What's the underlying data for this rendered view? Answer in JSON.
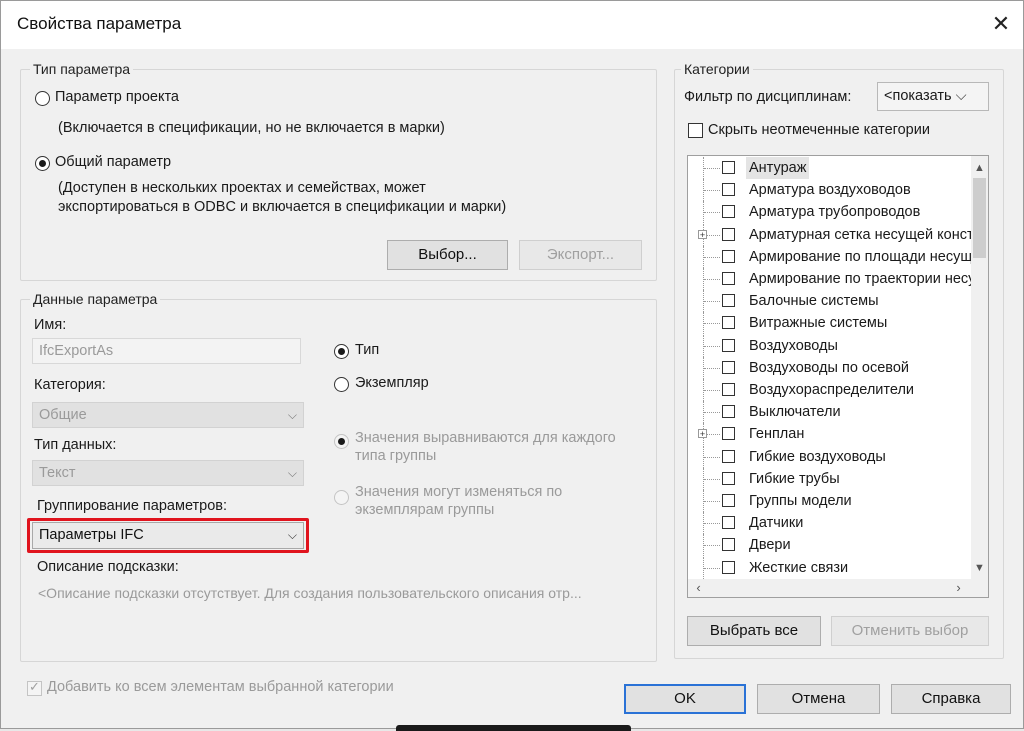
{
  "window": {
    "title": "Свойства параметра",
    "close_glyph": "✕"
  },
  "param_type": {
    "legend": "Тип параметра",
    "project_label": "Параметр проекта",
    "project_desc": "(Включается в спецификации, но не включается в марки)",
    "shared_label": "Общий параметр",
    "shared_desc_line1": "(Доступен в нескольких проектах и семействах, может",
    "shared_desc_line2": "экспортироваться в ODBC и включается в спецификации и марки)",
    "select_button": "Выбор...",
    "export_button": "Экспорт..."
  },
  "param_data": {
    "legend": "Данные параметра",
    "name_label": "Имя:",
    "name_value": "IfcExportAs",
    "category_label": "Категория:",
    "category_value": "Общие",
    "datatype_label": "Тип данных:",
    "datatype_value": "Текст",
    "grouping_label": "Группирование параметров:",
    "grouping_value": "Параметры IFC",
    "tooltip_label": "Описание подсказки:",
    "tooltip_value": "<Описание подсказки отсутствует. Для создания пользовательского описания отр...",
    "type_label": "Тип",
    "instance_label": "Экземпляр",
    "align_line1": "Значения выравниваются для каждого",
    "align_line2": "типа группы",
    "vary_line1": "Значения могут изменяться по",
    "vary_line2": "экземплярам группы"
  },
  "add_to_all_label": "Добавить ко всем элементам выбранной категории",
  "categories": {
    "legend": "Категории",
    "filter_label": "Фильтр по дисциплинам:",
    "filter_value": "<показать",
    "hide_unchecked": "Скрыть неотмеченные категории",
    "items": [
      {
        "label": "Антураж"
      },
      {
        "label": "Арматура воздуховодов"
      },
      {
        "label": "Арматура трубопроводов"
      },
      {
        "label": "Арматурная сетка несущей конструкции"
      },
      {
        "label": "Армирование по площади несущей конструкции"
      },
      {
        "label": "Армирование по траектории несущей конструкции"
      },
      {
        "label": "Балочные системы"
      },
      {
        "label": "Витражные системы"
      },
      {
        "label": "Воздуховоды"
      },
      {
        "label": "Воздуховоды по осевой"
      },
      {
        "label": "Воздухораспределители"
      },
      {
        "label": "Выключатели"
      },
      {
        "label": "Генплан"
      },
      {
        "label": "Гибкие воздуховоды"
      },
      {
        "label": "Гибкие трубы"
      },
      {
        "label": "Группы модели"
      },
      {
        "label": "Датчики"
      },
      {
        "label": "Двери"
      },
      {
        "label": "Жесткие связи"
      }
    ],
    "select_all": "Выбрать все",
    "deselect": "Отменить выбор"
  },
  "footer": {
    "ok": "OK",
    "cancel": "Отмена",
    "help": "Справка"
  },
  "colors": {
    "highlight_red": "#e0141e",
    "default_button_border": "#2a72d6"
  }
}
